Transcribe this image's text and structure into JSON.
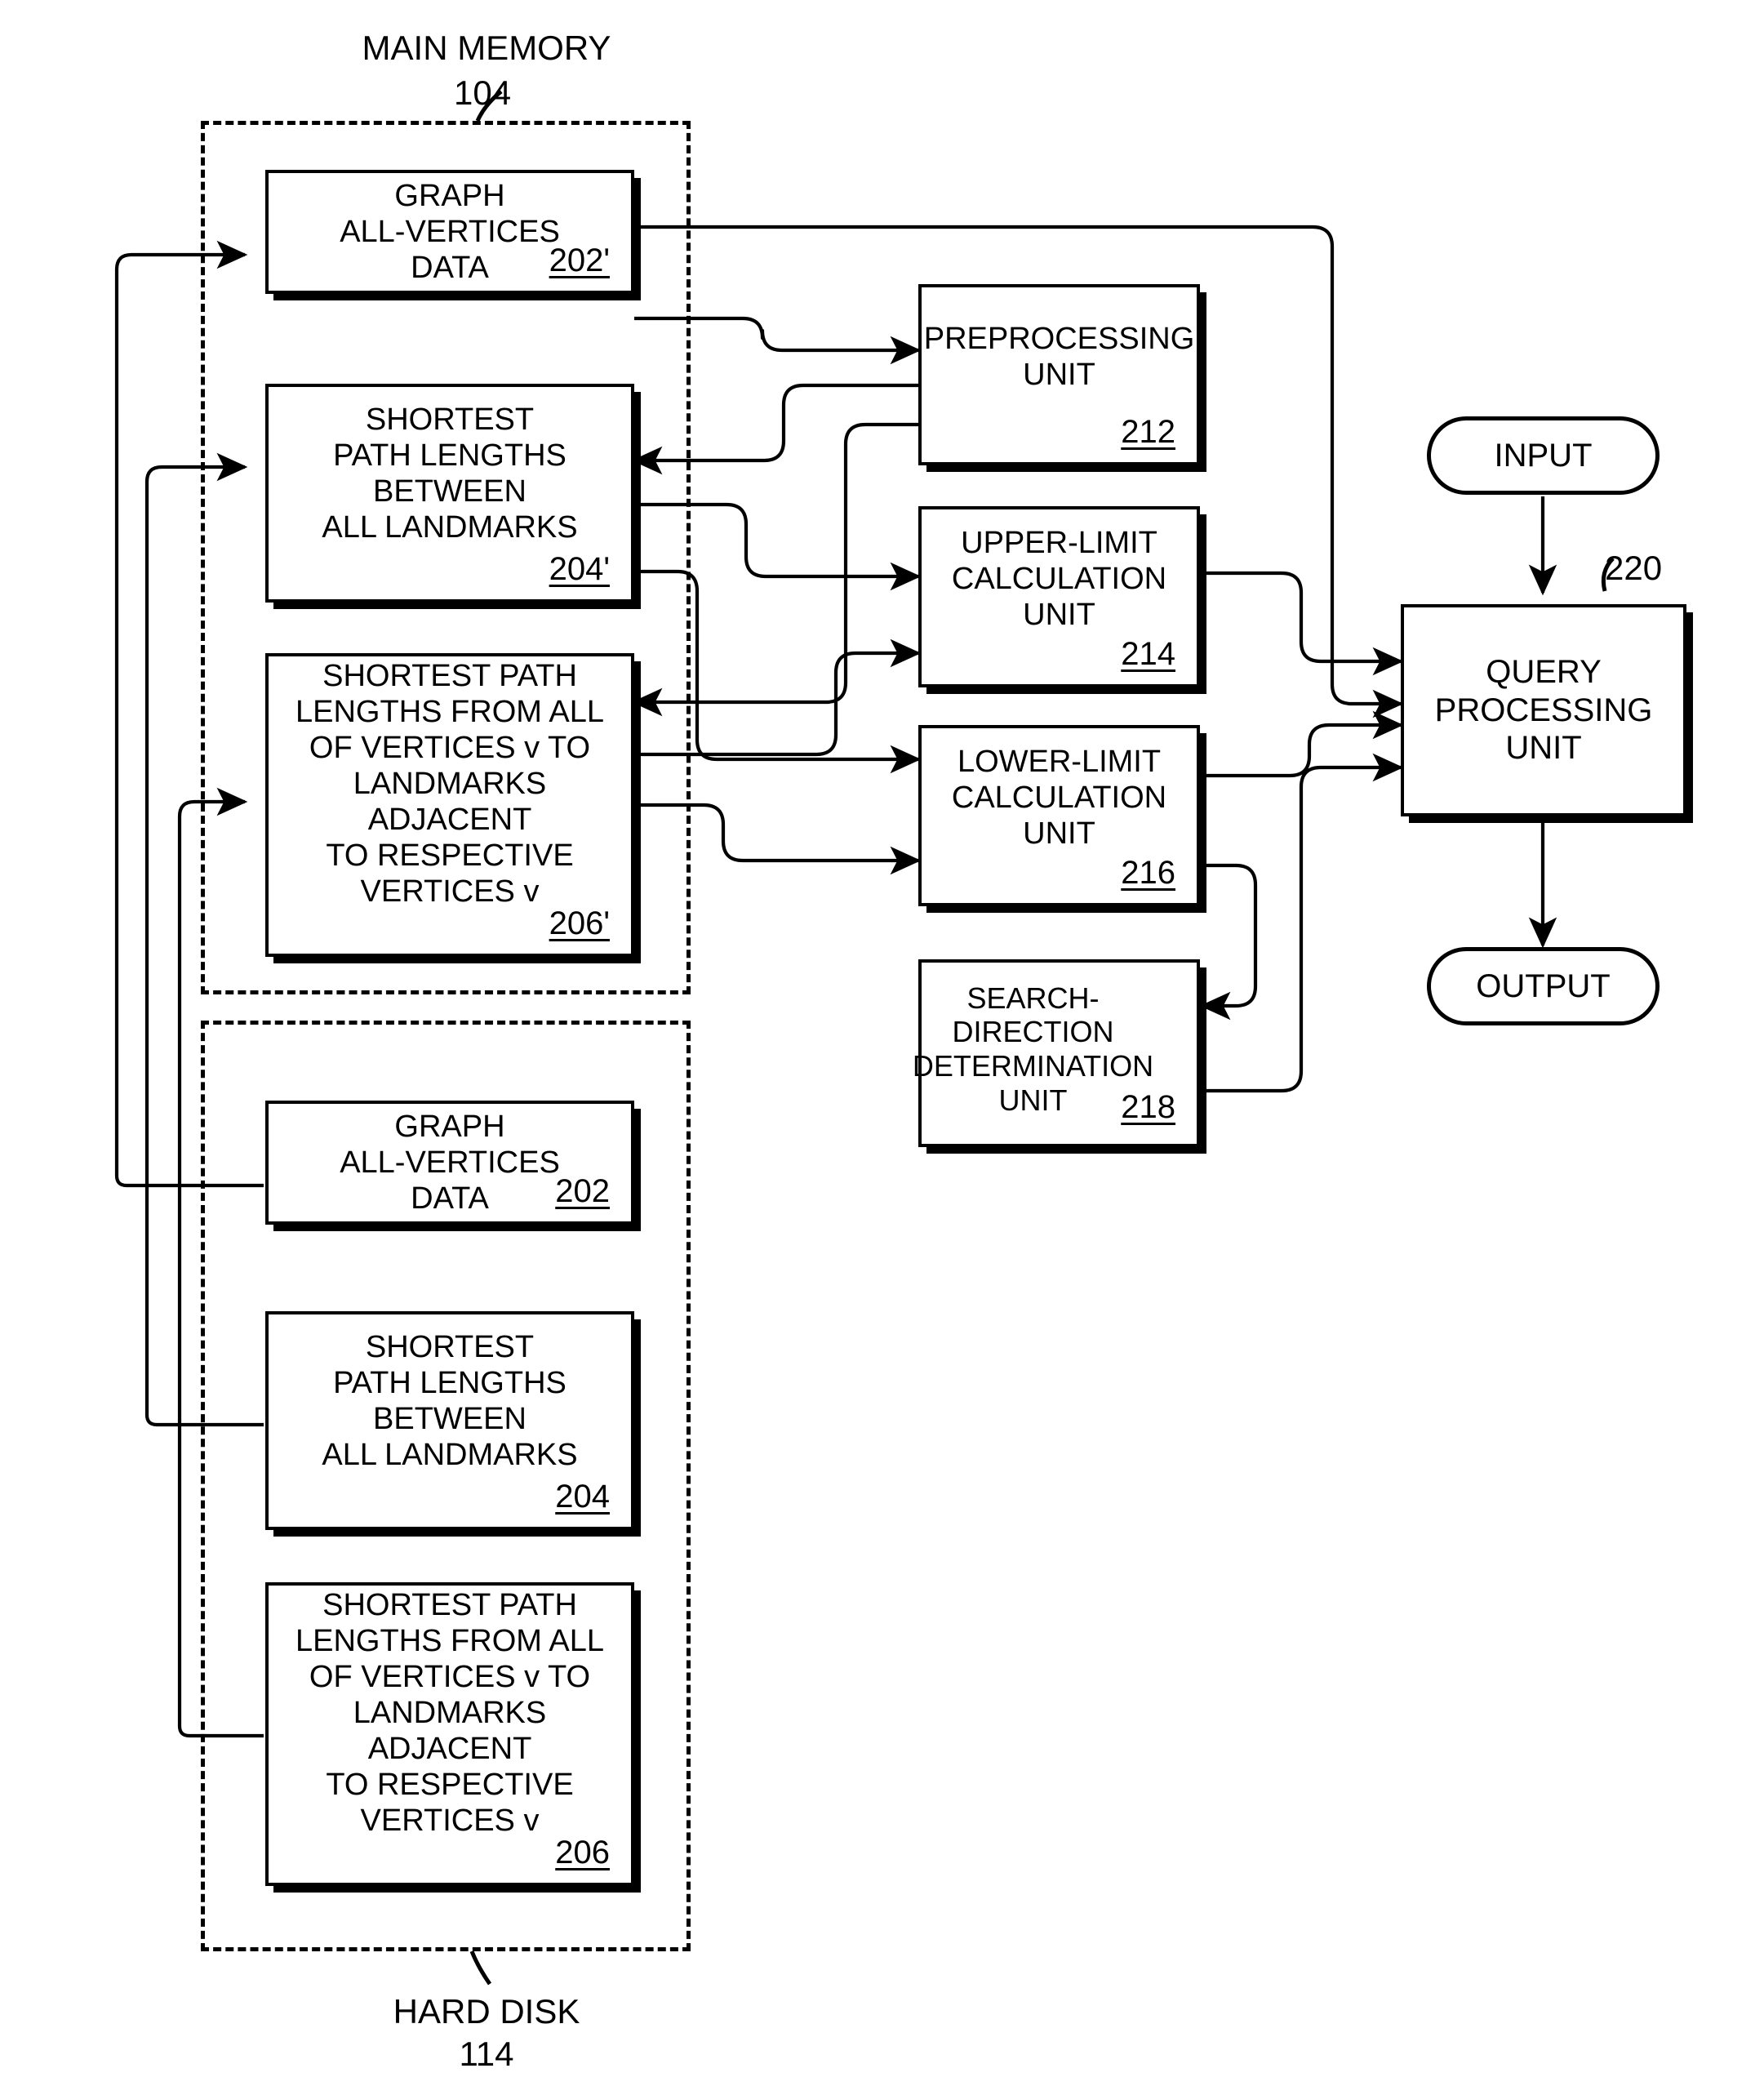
{
  "figure": {
    "containers": [
      {
        "id": "main-memory",
        "label": "MAIN MEMORY",
        "ref": "104"
      },
      {
        "id": "hard-disk",
        "label": "HARD DISK",
        "ref": "114"
      }
    ],
    "main_memory_blocks": [
      {
        "id": "graph-all-vertices-data-202p",
        "text": "GRAPH\nALL-VERTICES\nDATA",
        "ref": "202'"
      },
      {
        "id": "shortest-path-lengths-between-all-landmarks-204p",
        "text": "SHORTEST\nPATH LENGTHS\nBETWEEN\nALL LANDMARKS",
        "ref": "204'"
      },
      {
        "id": "shortest-path-lengths-from-all-vertices-206p",
        "text": "SHORTEST PATH\nLENGTHS FROM ALL\nOF VERTICES v TO\nLANDMARKS ADJACENT\nTO RESPECTIVE\nVERTICES v",
        "ref": "206'"
      }
    ],
    "hard_disk_blocks": [
      {
        "id": "graph-all-vertices-data-202",
        "text": "GRAPH\nALL-VERTICES\nDATA",
        "ref": "202"
      },
      {
        "id": "shortest-path-lengths-between-all-landmarks-204",
        "text": "SHORTEST\nPATH LENGTHS\nBETWEEN\nALL LANDMARKS",
        "ref": "204"
      },
      {
        "id": "shortest-path-lengths-from-all-vertices-206",
        "text": "SHORTEST PATH\nLENGTHS FROM ALL\nOF VERTICES v TO\nLANDMARKS ADJACENT\nTO RESPECTIVE\nVERTICES v",
        "ref": "206"
      }
    ],
    "processing_units": [
      {
        "id": "preprocessing-unit",
        "text": "PREPROCESSING\nUNIT",
        "ref": "212"
      },
      {
        "id": "upper-limit-calculation-unit",
        "text": "UPPER-LIMIT\nCALCULATION\nUNIT",
        "ref": "214"
      },
      {
        "id": "lower-limit-calculation-unit",
        "text": "LOWER-LIMIT\nCALCULATION\nUNIT",
        "ref": "216"
      },
      {
        "id": "search-direction-determination-unit",
        "text": "SEARCH-\nDIRECTION\nDETERMINATION\nUNIT",
        "ref": "218"
      }
    ],
    "query": {
      "input_label": "INPUT",
      "output_label": "OUTPUT",
      "unit_text": "QUERY\nPROCESSING\nUNIT",
      "unit_ref": "220"
    },
    "colors": {
      "ink": "#000000",
      "paper": "#ffffff"
    }
  }
}
